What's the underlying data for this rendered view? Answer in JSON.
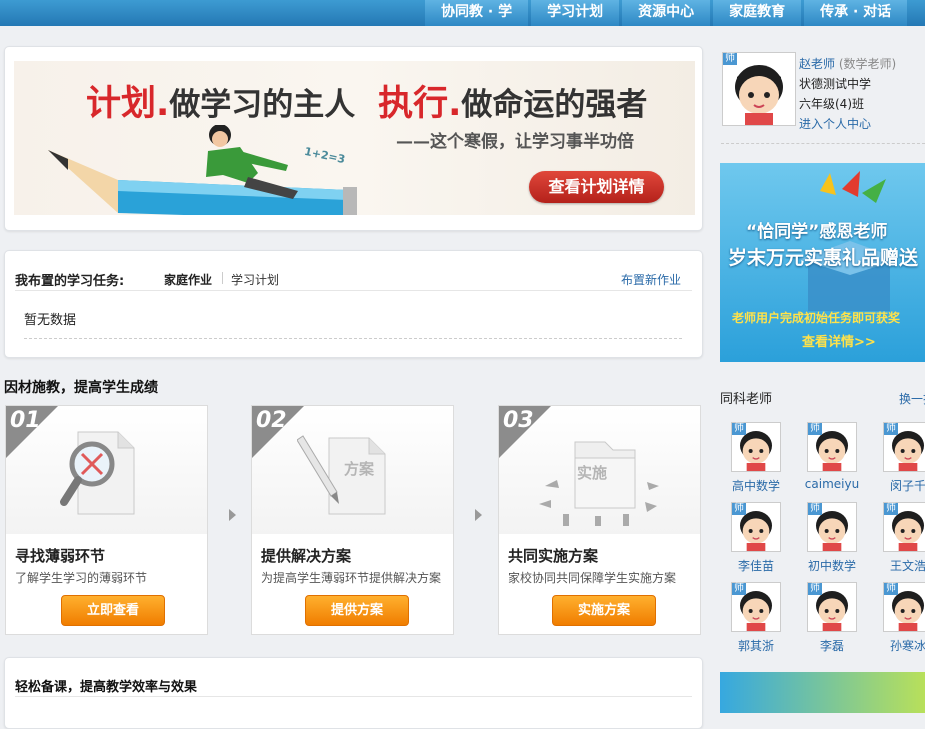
{
  "topnav": [
    "协同教 · 学",
    "学习计划",
    "资源中心",
    "家庭教育",
    "传承 · 对话"
  ],
  "banner": {
    "part1": "计划",
    "part2": "做学习的主人",
    "part3": "执行",
    "part4": "做命运的强者",
    "sub": "——这个寒假，让学习事半功倍",
    "button": "查看计划详情",
    "floating_text": "1+2=3"
  },
  "tasks": {
    "label": "我布置的学习任务:",
    "tab_homework": "家庭作业",
    "tab_plan": "学习计划",
    "new_link": "布置新作业",
    "empty": "暂无数据"
  },
  "section1_title": "因材施教，提高学生成绩",
  "steps": [
    {
      "num": "01",
      "title": "寻找薄弱环节",
      "desc": "了解学生学习的薄弱环节",
      "button": "立即查看",
      "icon_text": ""
    },
    {
      "num": "02",
      "title": "提供解决方案",
      "desc": "为提高学生薄弱环节提供解决方案",
      "button": "提供方案",
      "icon_text": "方案"
    },
    {
      "num": "03",
      "title": "共同实施方案",
      "desc": "家校协同共同保障学生实施方案",
      "button": "实施方案",
      "icon_text": "实施"
    }
  ],
  "section2_title": "轻松备课，提高教学效率与效果",
  "teacher": {
    "tag": "师",
    "name": "赵老师",
    "role": "(数学老师)",
    "school": "状德测试中学",
    "class": "六年级(4)班",
    "link": "进入个人中心"
  },
  "promo": {
    "l1": "“恰同学”感恩老师",
    "l2": "岁末万元实惠礼品赠送",
    "l3": "老师用户完成初始任务即可获奖",
    "l4": "查看详情>>"
  },
  "peers": {
    "title": "同科老师",
    "more": "换一换",
    "tag": "师",
    "list": [
      "高中数学",
      "caimeiyu",
      "闵子千",
      "李佳苗",
      "初中数学",
      "王文浩",
      "郭其浙",
      "李磊",
      "孙寒冰"
    ]
  }
}
